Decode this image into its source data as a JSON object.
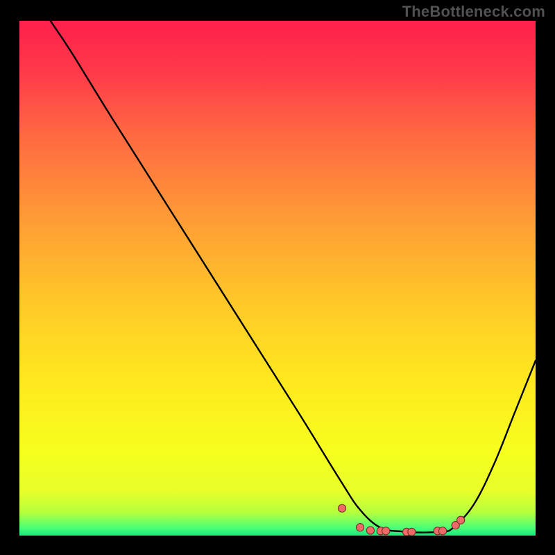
{
  "watermark": "TheBottleneck.com",
  "chart_data": {
    "type": "line",
    "title": "",
    "xlabel": "",
    "ylabel": "",
    "xlim": [
      0,
      100
    ],
    "ylim": [
      0,
      100
    ],
    "series": [
      {
        "name": "curve",
        "x": [
          6,
          10,
          18,
          30,
          42,
          54,
          62,
          66,
          70,
          74,
          78,
          82,
          84,
          88,
          92,
          96,
          100
        ],
        "y": [
          100,
          94,
          81,
          62,
          43,
          24,
          11,
          5,
          1.5,
          0.8,
          0.6,
          0.8,
          1.5,
          6,
          14,
          24,
          34
        ]
      }
    ],
    "markers": {
      "name": "near-min-points",
      "x": [
        62.5,
        66,
        68,
        70,
        71,
        75,
        76,
        81,
        82,
        84.5,
        85.5
      ],
      "y": [
        5.3,
        1.6,
        1.0,
        0.9,
        0.9,
        0.7,
        0.7,
        0.9,
        0.9,
        2.0,
        3.0
      ]
    },
    "gradient_stops": [
      {
        "offset": 0.0,
        "color": "#ff1f4b"
      },
      {
        "offset": 0.1,
        "color": "#ff3a4a"
      },
      {
        "offset": 0.22,
        "color": "#ff6842"
      },
      {
        "offset": 0.38,
        "color": "#ff9a36"
      },
      {
        "offset": 0.55,
        "color": "#ffc928"
      },
      {
        "offset": 0.7,
        "color": "#ffe81e"
      },
      {
        "offset": 0.84,
        "color": "#f6ff1e"
      },
      {
        "offset": 0.915,
        "color": "#e7ff2a"
      },
      {
        "offset": 0.955,
        "color": "#b6ff3d"
      },
      {
        "offset": 0.985,
        "color": "#4bff77"
      },
      {
        "offset": 1.0,
        "color": "#14e87b"
      }
    ],
    "curve_color": "#000000",
    "marker_fill": "#ed6a66",
    "marker_stroke": "#6b2a28"
  }
}
